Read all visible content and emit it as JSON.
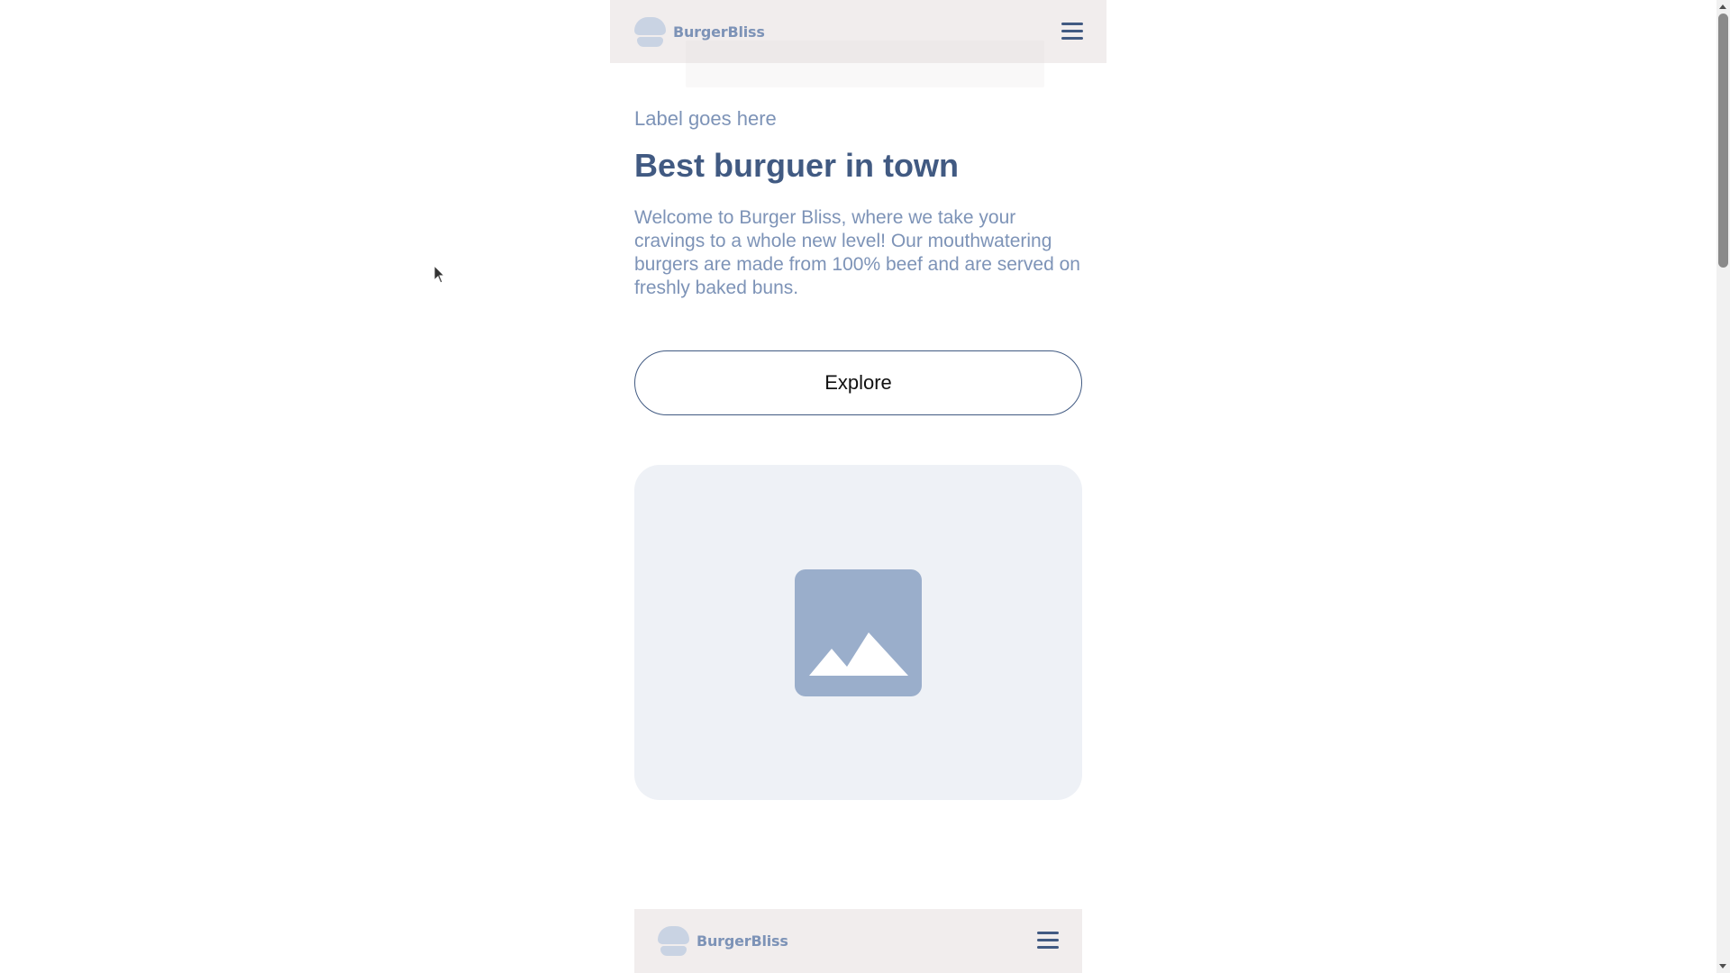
{
  "header": {
    "brand": "BurgerBliss",
    "logo_icon": "burger-icon",
    "menu_icon": "hamburger-menu-icon"
  },
  "hero": {
    "label": "Label goes here",
    "title": "Best burguer in town",
    "description": "Welcome to Burger Bliss, where we take your cravings to a whole new level! Our mouthwatering burgers are made from 100% beef and are served on freshly baked buns.",
    "cta_label": "Explore",
    "image_icon": "image-placeholder-icon"
  },
  "preview_header": {
    "brand": "BurgerBliss",
    "logo_icon": "burger-icon",
    "menu_icon": "hamburger-menu-icon"
  },
  "colors": {
    "navbar_bg": "#f1eded",
    "primary_text": "#415a82",
    "secondary_text": "#7d93b7",
    "card_bg": "#eef1f6",
    "placeholder_icon": "#9aaecb"
  }
}
